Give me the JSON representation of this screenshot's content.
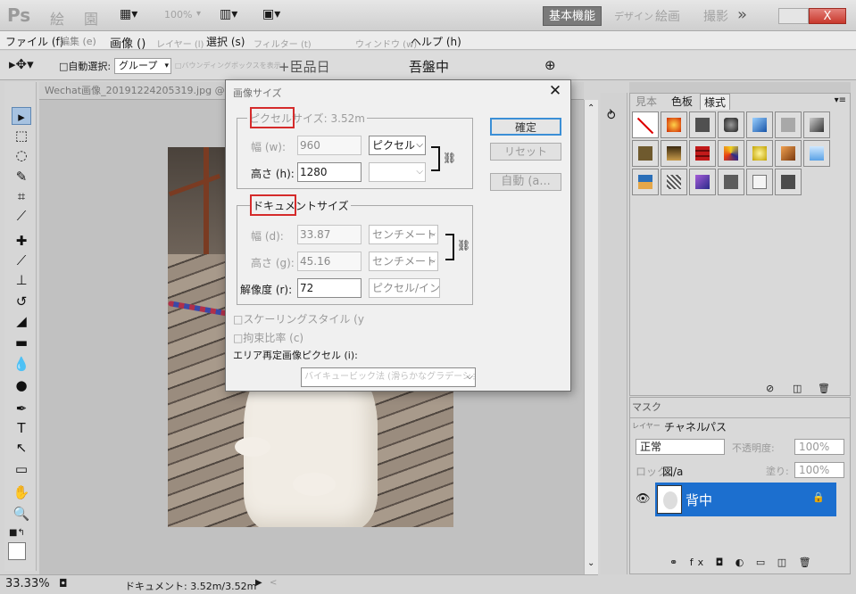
{
  "app": {
    "logo": "Ps",
    "zoom_combo": "100%",
    "workspace_active": "基本機能",
    "workspace_others": [
      "デザイン",
      "絵画",
      "撮影"
    ],
    "more_glyph": "»",
    "close_glyph": "X"
  },
  "menu": {
    "items": [
      "ファイル (f)",
      "編集 (e)",
      "画像 ()",
      "レイヤー (l)",
      "選択 (s)",
      "フィルター (t)",
      "ウィンドウ (w)",
      "ヘルプ (h)"
    ]
  },
  "options": {
    "auto_select_label": "□自動選択:",
    "auto_select_value": "グループ",
    "transform_text": "□バウンディングボックスを表示",
    "align_glyphs": "+臣品日",
    "distribute_glyphs": "吾盤中"
  },
  "doc": {
    "tab_title": "Wechat画像_20191224205319.jpg @ 33画像サイズ",
    "zoom": "33.33%",
    "status": "ドキュメント: 3.52m/3.52m"
  },
  "dialog": {
    "title": "画像サイズ",
    "close_glyph": "✕",
    "pixel_dims": {
      "legend": "ピクセルサイズ: 3.52m",
      "width_label": "幅 (w):",
      "width_value": "960",
      "width_unit": "ピクセル",
      "height_label": "高さ (h):",
      "height_value": "1280",
      "height_unit": ""
    },
    "doc_size": {
      "legend": "ドキュメントサイズ",
      "width_label": "幅 (d):",
      "width_value": "33.87",
      "width_unit": "センチメートル",
      "height_label": "高さ (g):",
      "height_value": "45.16",
      "height_unit": "センチメートル",
      "res_label": "解像度 (r):",
      "res_value": "72",
      "res_unit": "ピクセル/インチ"
    },
    "scale_styles": "□スケーリングスタイル (y",
    "constrain": "□拘束比率 (c)",
    "resample_label": "エリア再定画像ピクセル (i):",
    "resample_value": "バイキュービック法 (滑らかなグラデーション用)",
    "buttons": {
      "ok": "確定",
      "reset": "リセット",
      "auto": "自動 (a..."
    }
  },
  "styles_panel": {
    "tabs": [
      "見本",
      "色板",
      "様式"
    ],
    "active_tab": "様式"
  },
  "layers_panel": {
    "mask_tab": "マスク",
    "tabs": [
      "レイヤー",
      "チャネル",
      "パス"
    ],
    "blend_mode": "正常",
    "opacity_label": "不透明度:",
    "opacity_value": "100%",
    "lock_label": "ロック:",
    "lock_glyphs": "図/a",
    "fill_label": "塗り:",
    "fill_value": "100%",
    "layer_name": "背中",
    "footer_glyphs": "⚭ fx ◘ ◐ ▭ ◫ 🗑"
  },
  "colors": {
    "accent_blue": "#1c6fcf",
    "red_highlight": "#d52b2b",
    "close_red": "#c8382c"
  }
}
